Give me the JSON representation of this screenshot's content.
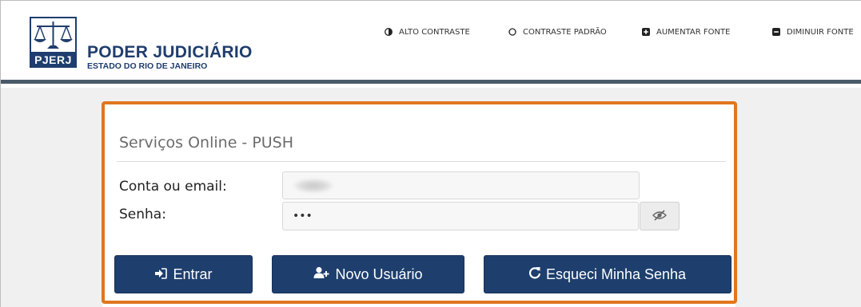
{
  "header": {
    "logo_text": "PJERJ",
    "title": "PODER JUDICIÁRIO",
    "subtitle": "ESTADO DO RIO DE JANEIRO",
    "accessibility": [
      {
        "label": "ALTO CONTRASTE",
        "icon": "contrast-half-icon"
      },
      {
        "label": "CONTRASTE PADRÃO",
        "icon": "circle-outline-icon"
      },
      {
        "label": "AUMENTAR FONTE",
        "icon": "plus-square-icon"
      },
      {
        "label": "DIMINUIR FONTE",
        "icon": "minus-square-icon"
      }
    ]
  },
  "login": {
    "title": "Serviços Online - PUSH",
    "user_label": "Conta ou email:",
    "user_value": "",
    "pass_label": "Senha:",
    "pass_value": "•••",
    "toggle_icon": "eye-slash-icon"
  },
  "buttons": {
    "enter": "Entrar",
    "new_user": "Novo Usuário",
    "forgot": "Esqueci Minha Senha"
  },
  "colors": {
    "primary": "#1e3f6e",
    "highlight": "#e0761e",
    "header_rule": "#4a5a68",
    "brand_text": "#1f3d6e"
  }
}
